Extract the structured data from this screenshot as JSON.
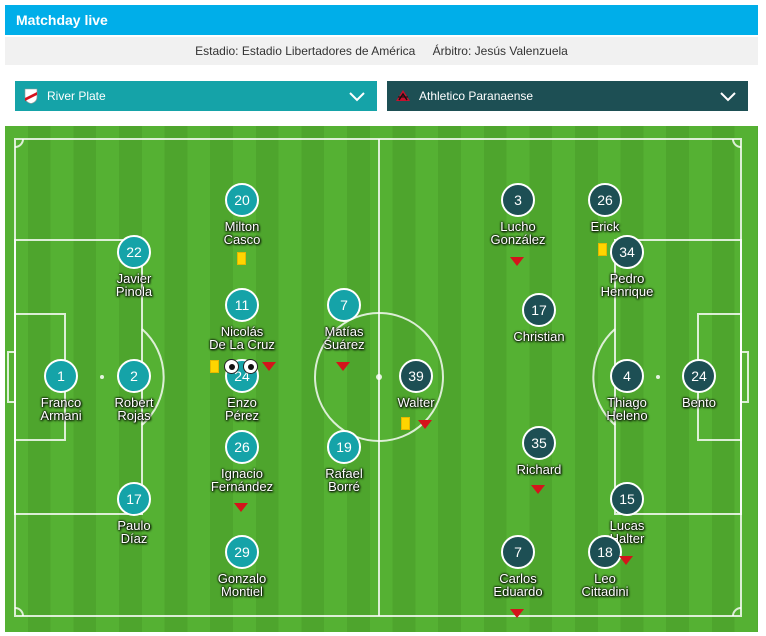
{
  "header": {
    "title": "Matchday live"
  },
  "info": {
    "stadium_label": "Estadio:",
    "stadium": "Estadio Libertadores de América",
    "referee_label": "Árbitro:",
    "referee": "Jesús Valenzuela"
  },
  "teams": {
    "home": {
      "name": "River Plate",
      "crest_icon": "river-plate-crest-icon",
      "color": "#15a3a8"
    },
    "away": {
      "name": "Athletico Paranaense",
      "crest_icon": "athletico-crest-icon",
      "color": "#1d4f54"
    }
  },
  "players": {
    "home": [
      {
        "number": "1",
        "line1": "Franco",
        "line2": "Armani"
      },
      {
        "number": "2",
        "line1": "Robert",
        "line2": "Rojas"
      },
      {
        "number": "22",
        "line1": "Javier",
        "line2": "Pinola"
      },
      {
        "number": "17",
        "line1": "Paulo",
        "line2": "Díaz"
      },
      {
        "number": "20",
        "line1": "Milton",
        "line2": "Casco"
      },
      {
        "number": "11",
        "line1": "Nicolás",
        "line2": "De La Cruz"
      },
      {
        "number": "24",
        "line1": "Enzo",
        "line2": "Pérez"
      },
      {
        "number": "26",
        "line1": "Ignacio",
        "line2": "Fernández"
      },
      {
        "number": "29",
        "line1": "Gonzalo",
        "line2": "Montiel"
      },
      {
        "number": "7",
        "line1": "Matías",
        "line2": "Suárez"
      },
      {
        "number": "19",
        "line1": "Rafael",
        "line2": "Borré"
      }
    ],
    "away": [
      {
        "number": "24",
        "line1": "Bento",
        "line2": ""
      },
      {
        "number": "4",
        "line1": "Thiago",
        "line2": "Heleno"
      },
      {
        "number": "34",
        "line1": "Pedro",
        "line2": "Henrique"
      },
      {
        "number": "15",
        "line1": "Lucas",
        "line2": "Halter"
      },
      {
        "number": "26",
        "line1": "Erick",
        "line2": ""
      },
      {
        "number": "17",
        "line1": "Christian",
        "line2": ""
      },
      {
        "number": "35",
        "line1": "Richard",
        "line2": ""
      },
      {
        "number": "18",
        "line1": "Leo",
        "line2": "Cittadini"
      },
      {
        "number": "3",
        "line1": "Lucho",
        "line2": "González"
      },
      {
        "number": "7",
        "line1": "Carlos",
        "line2": "Eduardo"
      },
      {
        "number": "39",
        "line1": "Walter",
        "line2": ""
      }
    ]
  },
  "event_icons": {
    "yellow_card": "yellow-card-icon",
    "substitution": "substitution-arrow-icon",
    "goal": "goal-ball-icon"
  },
  "colors": {
    "header": "#00aee9",
    "pitch_light": "#55b133",
    "pitch_dark": "#4ea52d",
    "sub_arrow": "#d4141b",
    "card": "#ffd500"
  }
}
